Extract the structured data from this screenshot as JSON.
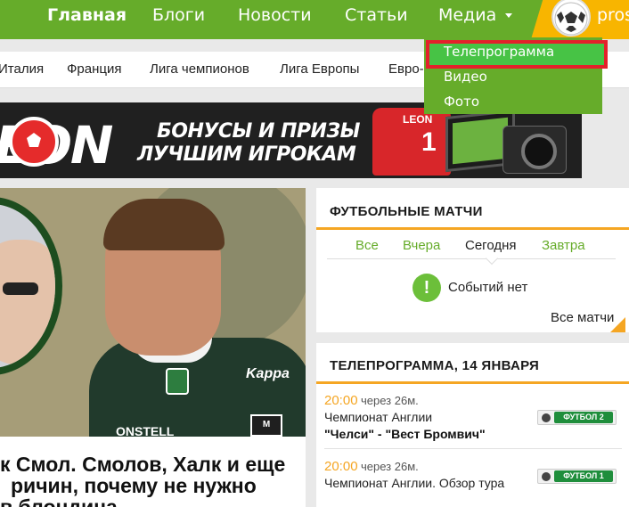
{
  "topnav": {
    "items": [
      "Главная",
      "Блоги",
      "Новости",
      "Статьи",
      "Медиа"
    ],
    "user_name": "pros"
  },
  "media_menu": {
    "items": [
      "Телепрограмма",
      "Видео",
      "Фото"
    ]
  },
  "subnav": {
    "items": [
      "Италия",
      "Франция",
      "Лига чемпионов",
      "Лига Европы",
      "Евро-"
    ]
  },
  "banner": {
    "logo": "EON",
    "line1": "БОНУСЫ И ПРИЗЫ",
    "line2": "ЛУЧШИМ ИГРОКАМ",
    "shirt_brand": "LEON",
    "shirt_number": "1"
  },
  "hero": {
    "sponsor": "ONSTELL",
    "kit_brand": "Kappa",
    "badge": "M NEG",
    "headline": [
      "к Смол. Смолов, Халк и еще",
      "ричин, почему не нужно",
      "в блондина"
    ]
  },
  "matches": {
    "title": "ФУТБОЛЬНЫЕ МАТЧИ",
    "tabs": [
      "Все",
      "Вчера",
      "Сегодня",
      "Завтра"
    ],
    "active_tab": "Сегодня",
    "no_events": "Событий нет",
    "all_link": "Все матчи"
  },
  "tv": {
    "title": "ТЕЛЕПРОГРАММА, 14 ЯНВАРЯ",
    "rows": [
      {
        "time": "20:00",
        "eta": "через 26м.",
        "title": "Чемпионат Англии",
        "subtitle": "\"Челси\" - \"Вест Бромвич\"",
        "channel": "ФУТБОЛ 2"
      },
      {
        "time": "20:00",
        "eta": "через 26м.",
        "title": "Чемпионат Англии. Обзор тура",
        "subtitle": "",
        "channel": "ФУТБОЛ 1"
      }
    ]
  },
  "colors": {
    "brand_green": "#66ac2a",
    "accent_orange": "#f5a623",
    "highlight_red": "#e3212b"
  }
}
